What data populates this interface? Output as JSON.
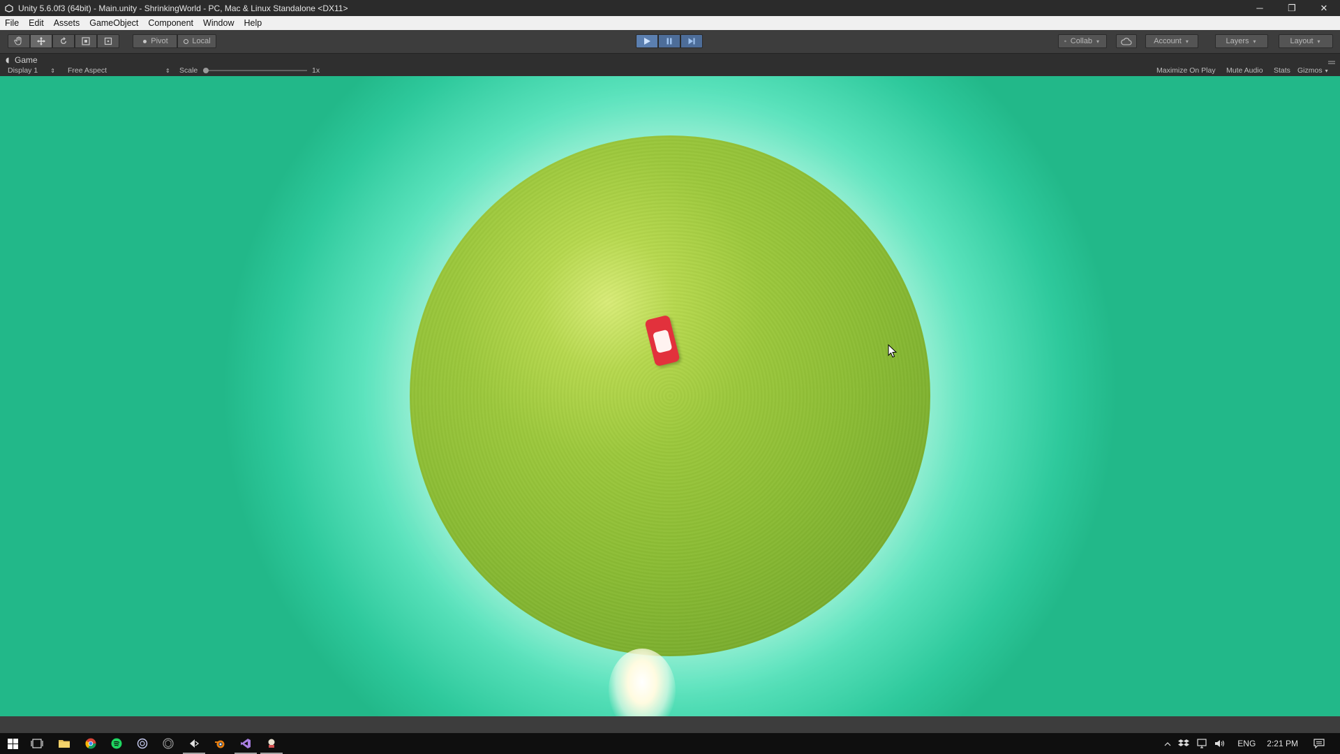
{
  "window": {
    "title": "Unity 5.6.0f3 (64bit) - Main.unity - ShrinkingWorld - PC, Mac & Linux Standalone <DX11>",
    "minimize": "─",
    "restore": "❐",
    "close": "✕"
  },
  "menu": [
    "File",
    "Edit",
    "Assets",
    "GameObject",
    "Component",
    "Window",
    "Help"
  ],
  "toolbar": {
    "pivot_label": "Pivot",
    "local_label": "Local",
    "collab_label": "Collab",
    "account_label": "Account",
    "layers_label": "Layers",
    "layout_label": "Layout"
  },
  "game_view": {
    "tab_label": "Game",
    "display_label": "Display 1",
    "aspect_label": "Free Aspect",
    "scale_label": "Scale",
    "scale_value": "1x",
    "maximize_label": "Maximize On Play",
    "mute_label": "Mute Audio",
    "stats_label": "Stats",
    "gizmos_label": "Gizmos"
  },
  "taskbar": {
    "language": "ENG",
    "time": "2:21 PM"
  },
  "colors": {
    "sky_center": "#d9fbe7",
    "sky_edge": "#22b889",
    "planet": "#9cc83c",
    "car": "#e2313c",
    "play_accent": "#5b7fb0"
  }
}
